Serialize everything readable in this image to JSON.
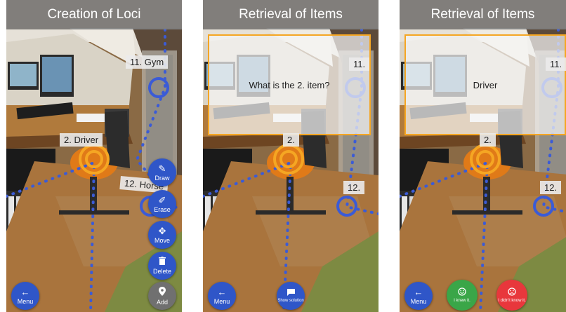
{
  "panels": [
    {
      "title": "Creation of Loci",
      "tags": {
        "gym": "11. Gym",
        "driver": "2. Driver",
        "horse": "12. Horse"
      },
      "buttons": {
        "draw": "Draw",
        "erase": "Erase",
        "move": "Move",
        "delete": "Delete",
        "add": "Add",
        "menu": "Menu"
      }
    },
    {
      "title": "Retrieval of Items",
      "tags": {
        "gym": "11.",
        "driver": "2.",
        "horse": "12."
      },
      "prompt": "What is the 2. item?",
      "buttons": {
        "menu": "Menu",
        "show_solution": "Show solution"
      }
    },
    {
      "title": "Retrieval of Items",
      "tags": {
        "gym": "11.",
        "driver": "2.",
        "horse": "12."
      },
      "prompt": "Driver",
      "buttons": {
        "menu": "Menu",
        "knew": "I knew it.",
        "didnt_know": "I didn't know it."
      }
    }
  ],
  "colors": {
    "fab": "#2f56c8",
    "locus": "#f5a623",
    "path": "#3b5bd6",
    "knew": "#3aa648",
    "didnt_know": "#e8373c",
    "disabled": "#707070"
  },
  "icons": [
    "pencil-icon",
    "eraser-icon",
    "move-arrows-icon",
    "trash-icon",
    "location-pin-icon",
    "back-arrow-icon",
    "chat-icon",
    "smile-icon",
    "frown-icon"
  ]
}
